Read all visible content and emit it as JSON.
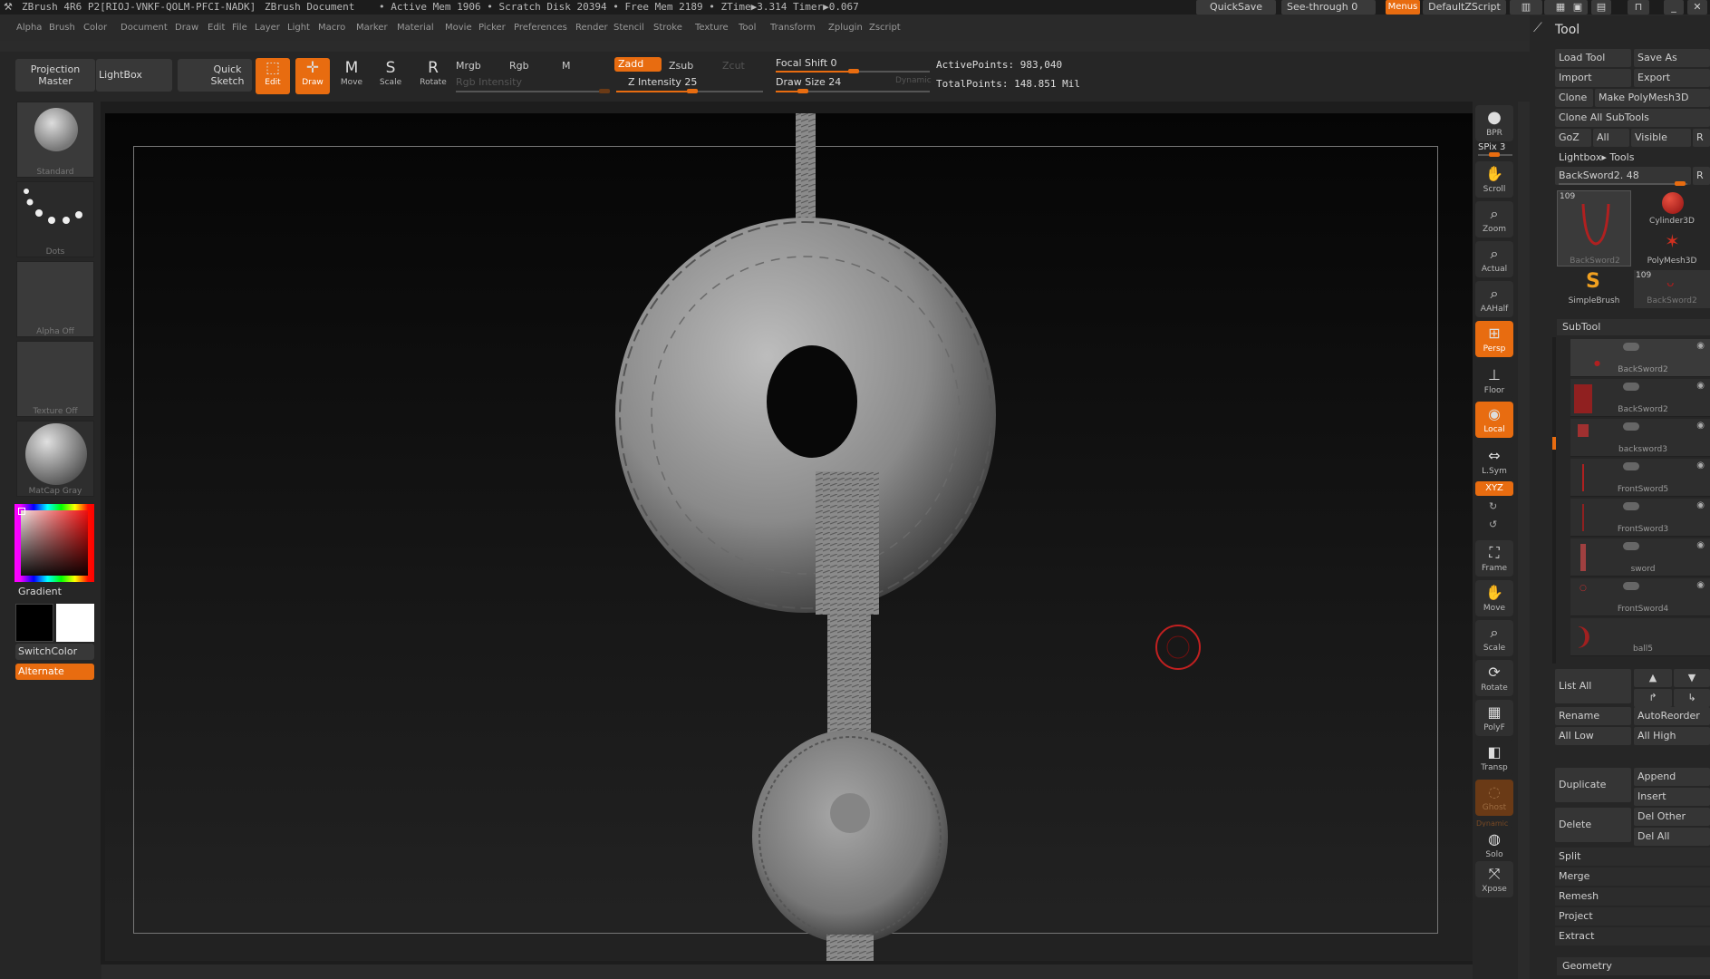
{
  "titlebar": {
    "app": "ZBrush 4R6 P2[RIOJ-VNKF-QOLM-PFCI-NADK]",
    "document": "ZBrush Document",
    "stats": "• Active Mem 1906 • Scratch Disk 20394 • Free Mem 2189 • ZTime▶3.314 Timer▶0.067",
    "quicksave": "QuickSave",
    "see_through": "See-through  0",
    "menus": "Menus",
    "default_zscript": "DefaultZScript"
  },
  "menubar": [
    "Alpha",
    "Brush",
    "Color",
    "Document",
    "Draw",
    "Edit",
    "File",
    "Layer",
    "Light",
    "Macro",
    "Marker",
    "Material",
    "Movie",
    "Picker",
    "Preferences",
    "Render",
    "Stencil",
    "Stroke",
    "Texture",
    "Tool",
    "Transform",
    "Zplugin",
    "Zscript"
  ],
  "toolbar": {
    "projection_master": "Projection Master",
    "lightbox": "LightBox",
    "quick_sketch": "Quick Sketch",
    "edit": "Edit",
    "draw": "Draw",
    "move": "Move",
    "scale": "Scale",
    "rotate": "Rotate",
    "mrgb": "Mrgb",
    "rgb": "Rgb",
    "m": "M",
    "rgb_intensity": "Rgb Intensity",
    "zadd": "Zadd",
    "zsub": "Zsub",
    "zcut": "Zcut",
    "z_intensity": "Z Intensity 25",
    "focal_shift": "Focal Shift 0",
    "draw_size": "Draw Size 24",
    "dynamic": "Dynamic",
    "active_points": "ActivePoints: 983,040",
    "total_points": "TotalPoints: 148.851 Mil"
  },
  "left": {
    "brush": "Standard",
    "stroke": "Dots",
    "alpha": "Alpha Off",
    "texture": "Texture Off",
    "material": "MatCap Gray",
    "gradient": "Gradient",
    "switchcolor": "SwitchColor",
    "alternate": "Alternate"
  },
  "shelf": {
    "bpr": "BPR",
    "spix": "SPix 3",
    "scroll": "Scroll",
    "zoom": "Zoom",
    "actual": "Actual",
    "aahalf": "AAHalf",
    "persp": "Persp",
    "floor": "Floor",
    "local": "Local",
    "lsym": "L.Sym",
    "xyz": "XYZ",
    "frame": "Frame",
    "move": "Move",
    "scale": "Scale",
    "rotate": "Rotate",
    "polyf": "PolyF",
    "transp": "Transp",
    "ghost": "Ghost",
    "dynamic": "Dynamic",
    "solo": "Solo",
    "xpose": "Xpose"
  },
  "tool": {
    "title": "Tool",
    "load_tool": "Load Tool",
    "save_as": "Save As",
    "import": "Import",
    "export": "Export",
    "clone": "Clone",
    "make_polymesh": "Make PolyMesh3D",
    "clone_all": "Clone All SubTools",
    "goz": "GoZ",
    "all": "All",
    "visible": "Visible",
    "r": "R",
    "lightbox_tools": "Lightbox▸ Tools",
    "current_tool": "BackSword2. 48",
    "thumbs": [
      {
        "label": "BackSword2",
        "count": "109"
      },
      {
        "label": "Cylinder3D",
        "count": ""
      },
      {
        "label": "PolyMesh3D",
        "count": ""
      },
      {
        "label": "SimpleBrush",
        "count": ""
      },
      {
        "label": "BackSword2",
        "count": "109"
      }
    ],
    "subtool_header": "SubTool",
    "subtools": [
      "BackSword2",
      "BackSword2",
      "backsword3",
      "FrontSword5",
      "FrontSword3",
      "sword",
      "FrontSword4",
      "ball5"
    ],
    "list_all": "List All",
    "rename": "Rename",
    "autoreorder": "AutoReorder",
    "all_low": "All Low",
    "all_high": "All High",
    "duplicate": "Duplicate",
    "append": "Append",
    "insert": "Insert",
    "delete": "Delete",
    "del_other": "Del Other",
    "del_all": "Del All",
    "split": "Split",
    "merge": "Merge",
    "remesh": "Remesh",
    "project": "Project",
    "extract": "Extract",
    "geometry": "Geometry"
  },
  "colors": {
    "accent": "#e86c10",
    "panel": "#262626",
    "button": "#383838"
  }
}
